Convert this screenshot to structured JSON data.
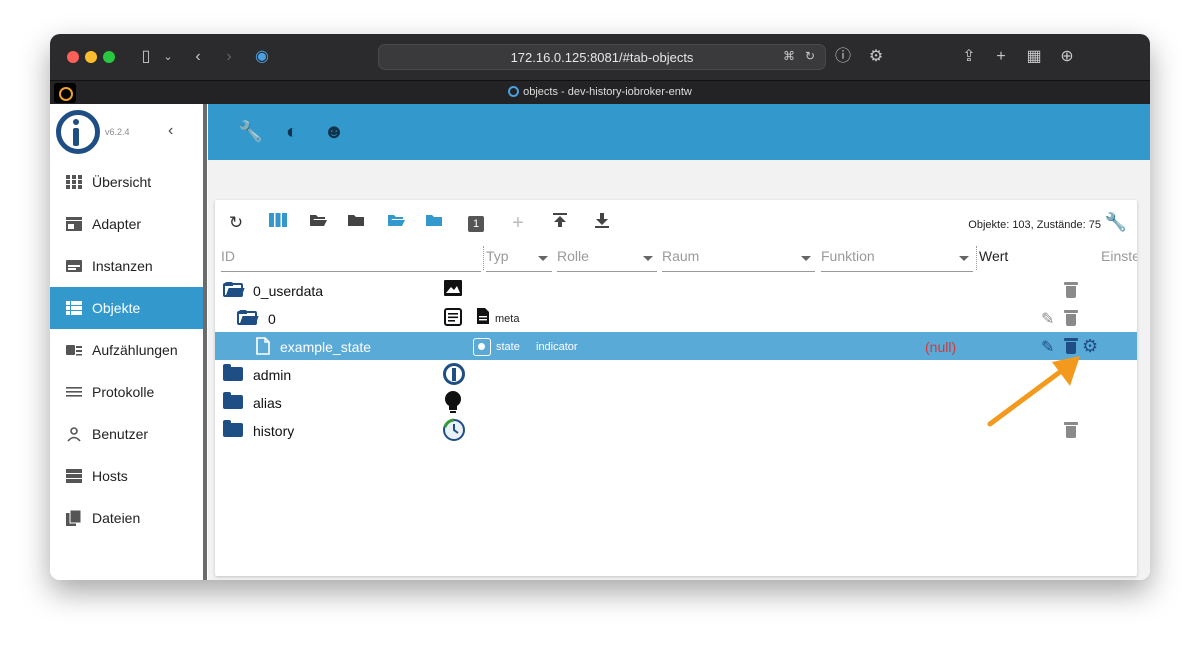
{
  "browser": {
    "url": "172.16.0.125:8081/#tab-objects",
    "tab_title": "objects - dev-history-iobroker-entw"
  },
  "sidebar": {
    "version": "v6.2.4",
    "items": [
      {
        "label": "Übersicht",
        "icon": "grid-icon"
      },
      {
        "label": "Adapter",
        "icon": "store-icon"
      },
      {
        "label": "Instanzen",
        "icon": "instances-icon"
      },
      {
        "label": "Objekte",
        "icon": "list-icon",
        "active": true
      },
      {
        "label": "Aufzählungen",
        "icon": "enum-icon"
      },
      {
        "label": "Protokolle",
        "icon": "log-icon"
      },
      {
        "label": "Benutzer",
        "icon": "user-icon"
      },
      {
        "label": "Hosts",
        "icon": "hosts-icon"
      },
      {
        "label": "Dateien",
        "icon": "files-icon"
      }
    ]
  },
  "stats": "Objekte: 103, Zustände: 75",
  "columns": {
    "id": "ID",
    "typ": "Typ",
    "rolle": "Rolle",
    "raum": "Raum",
    "funktion": "Funktion",
    "wert": "Wert",
    "einstellungen": "Einste"
  },
  "rows": [
    {
      "label": "0_userdata"
    },
    {
      "label": "0",
      "typ": "meta"
    },
    {
      "label": "example_state",
      "typ": "state",
      "rolle": "indicator",
      "wert": "(null)"
    },
    {
      "label": "admin"
    },
    {
      "label": "alias"
    },
    {
      "label": "history"
    }
  ],
  "toolbar_badge": "1",
  "colors": {
    "accent": "#3399cc",
    "selected_row": "#5aaad8",
    "dark_blue": "#1f4e85",
    "arrow": "#f39a1e"
  }
}
